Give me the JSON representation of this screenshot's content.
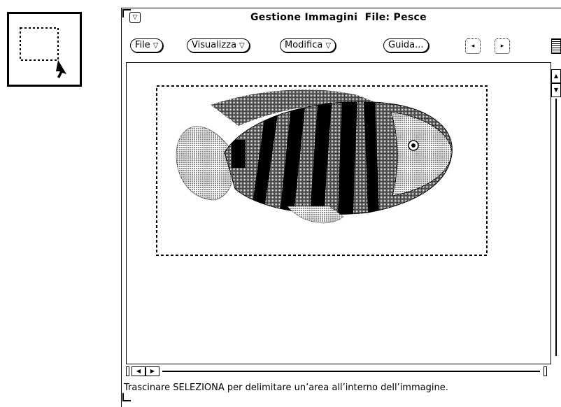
{
  "tool_icon": {
    "name": "selection-tool-icon"
  },
  "window": {
    "title": "Gestione Immagini  File: Pesce",
    "menu_glyph": "▽"
  },
  "toolbar": {
    "menus": [
      {
        "label": "File",
        "arrow": "▽"
      },
      {
        "label": "Visualizza",
        "arrow": "▽"
      },
      {
        "label": "Modifica",
        "arrow": "▽"
      }
    ],
    "help_label": "Guida...",
    "prev_glyph": "◂",
    "next_glyph": "▸"
  },
  "scroll": {
    "up": "▲",
    "down": "▼",
    "left": "◀",
    "right": "▶"
  },
  "footer": {
    "message": "Trascinare SELEZIONA per delimitare un’area all’interno dell’immagine."
  },
  "image": {
    "subject": "fish-image"
  }
}
